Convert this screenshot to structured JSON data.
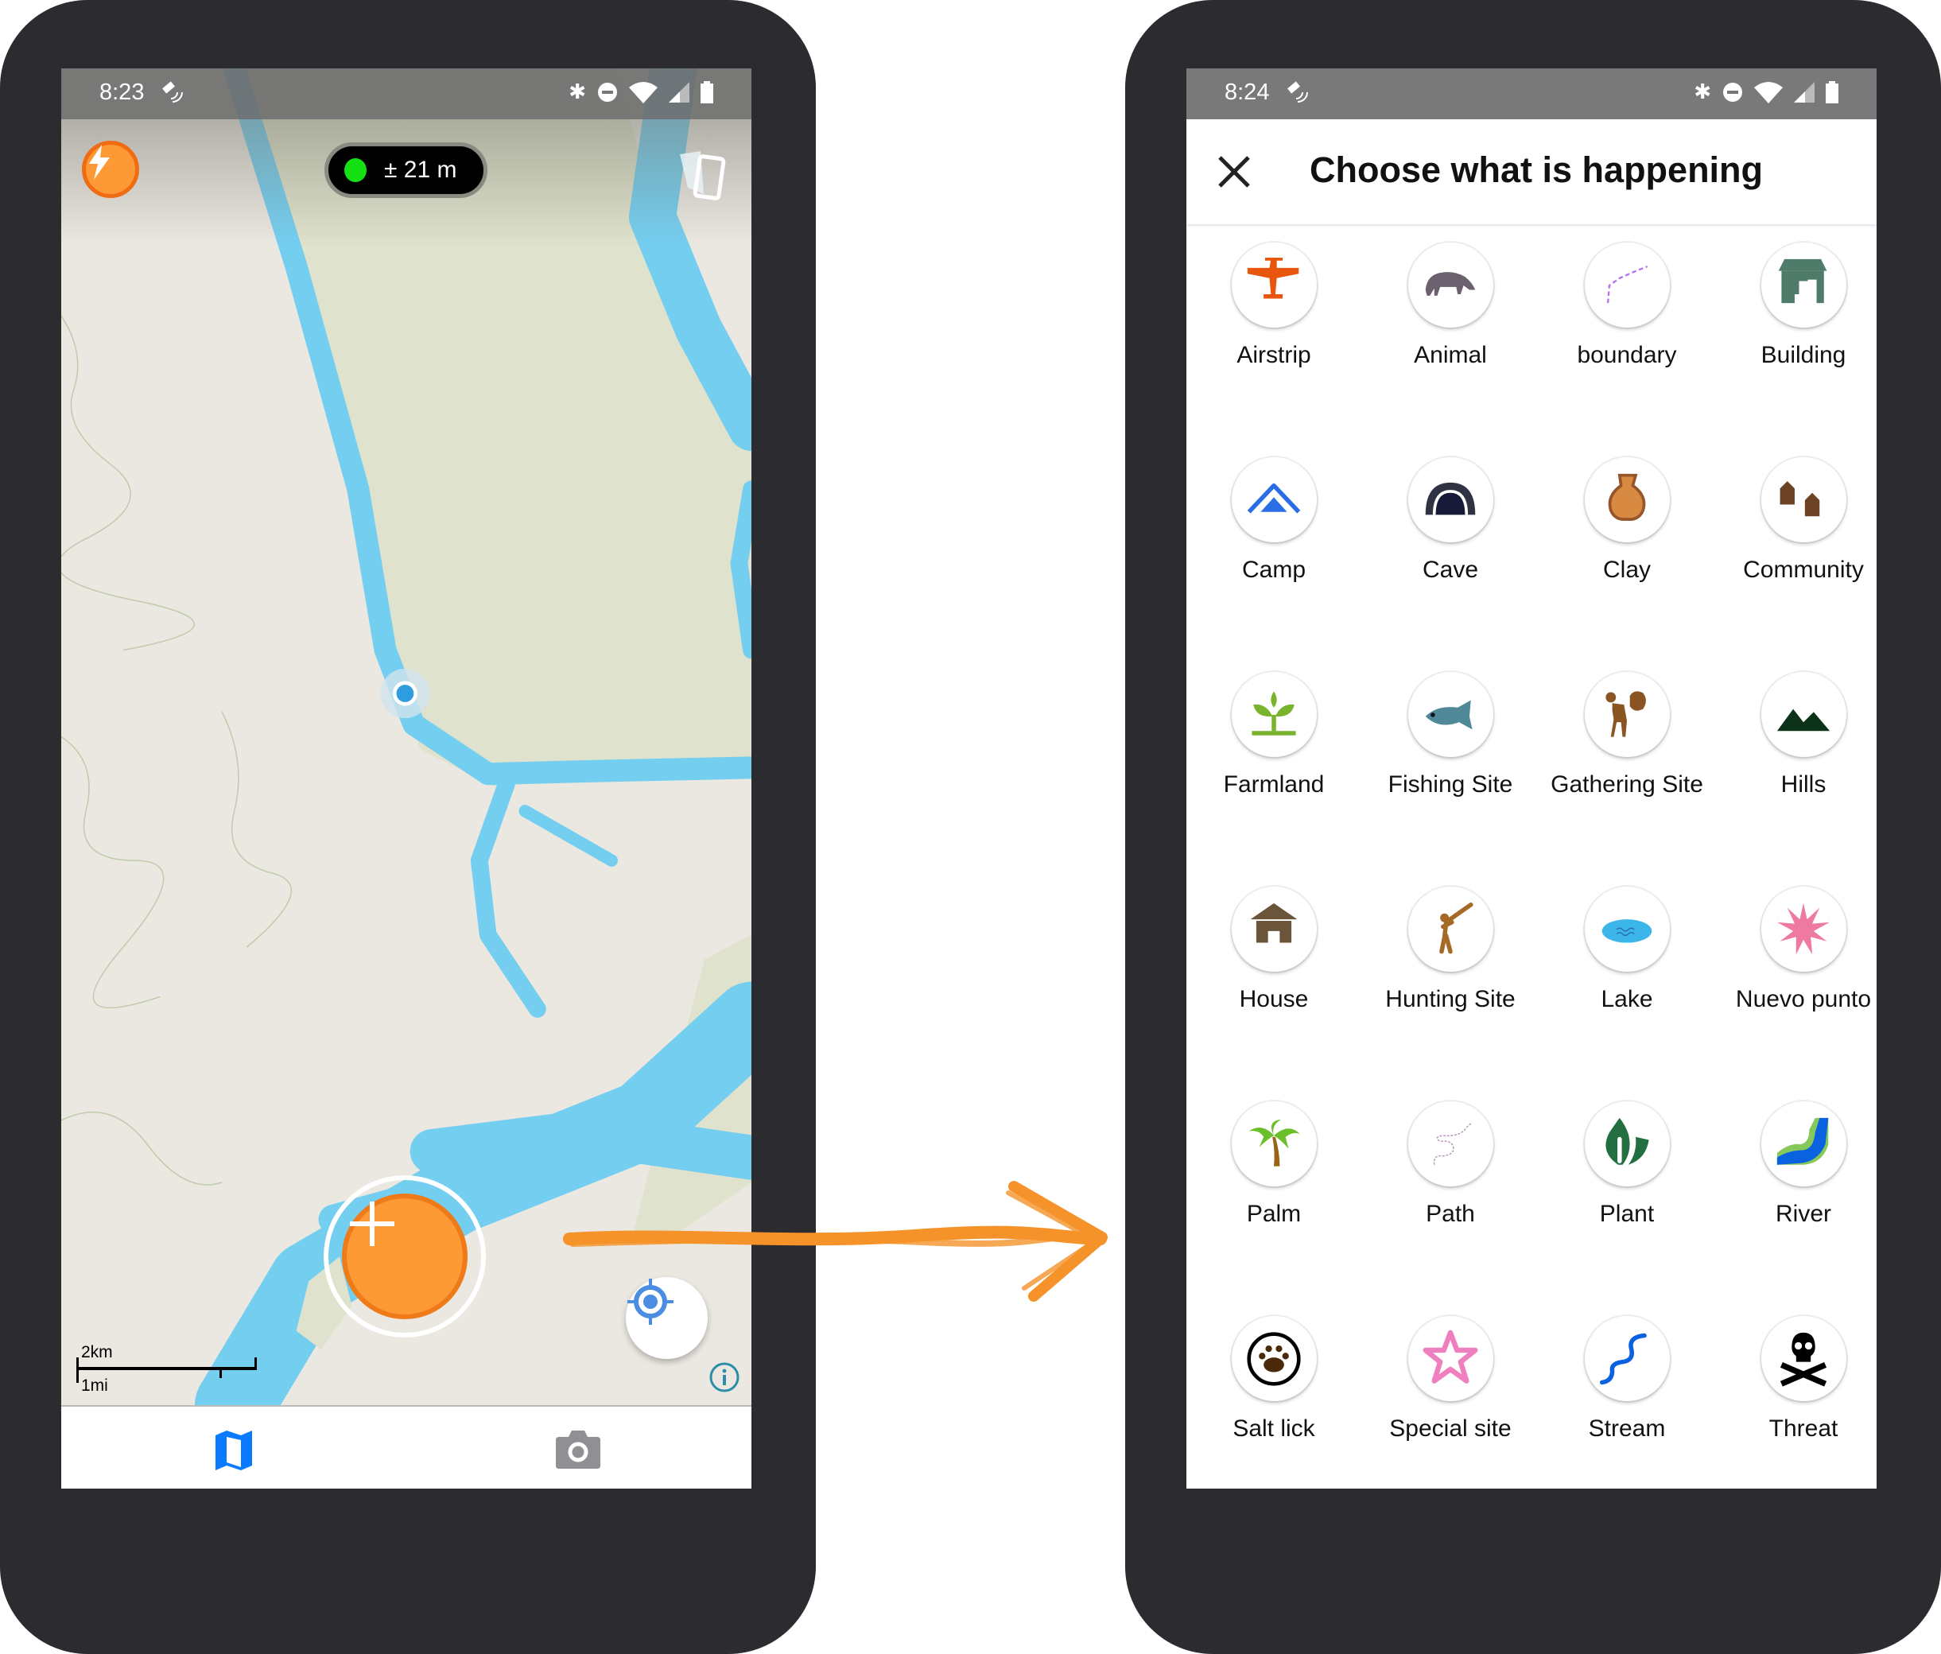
{
  "left_phone": {
    "status_bar": {
      "time": "8:23"
    },
    "gps_accuracy": "± 21 m",
    "scale_bar": {
      "metric": "2km",
      "imperial": "1mi"
    },
    "bottom_nav": [
      {
        "icon": "map-icon",
        "active": true
      },
      {
        "icon": "camera-icon",
        "active": false
      }
    ]
  },
  "right_phone": {
    "status_bar": {
      "time": "8:24"
    },
    "header": {
      "title": "Choose what is happening"
    },
    "categories": [
      {
        "label": "Airstrip",
        "icon": "airplane"
      },
      {
        "label": "Animal",
        "icon": "animal"
      },
      {
        "label": "boundary",
        "icon": "boundary"
      },
      {
        "label": "Building",
        "icon": "building"
      },
      {
        "label": "Camp",
        "icon": "camp"
      },
      {
        "label": "Cave",
        "icon": "cave"
      },
      {
        "label": "Clay",
        "icon": "clay"
      },
      {
        "label": "Community",
        "icon": "community"
      },
      {
        "label": "Farmland",
        "icon": "farmland"
      },
      {
        "label": "Fishing Site",
        "icon": "fish"
      },
      {
        "label": "Gathering Site",
        "icon": "gathering"
      },
      {
        "label": "Hills",
        "icon": "hills"
      },
      {
        "label": "House",
        "icon": "house"
      },
      {
        "label": "Hunting Site",
        "icon": "hunting"
      },
      {
        "label": "Lake",
        "icon": "lake"
      },
      {
        "label": "Nuevo punto",
        "icon": "starburst"
      },
      {
        "label": "Palm",
        "icon": "palm"
      },
      {
        "label": "Path",
        "icon": "path"
      },
      {
        "label": "Plant",
        "icon": "plant"
      },
      {
        "label": "River",
        "icon": "river"
      },
      {
        "label": "Salt lick",
        "icon": "paw"
      },
      {
        "label": "Special site",
        "icon": "star"
      },
      {
        "label": "Stream",
        "icon": "stream"
      },
      {
        "label": "Threat",
        "icon": "skull"
      }
    ]
  },
  "colors": {
    "accent_orange": "#fd9a35",
    "water": "#74cef0",
    "land_green": "#dfe2cc",
    "nav_active": "#0a7bff"
  }
}
